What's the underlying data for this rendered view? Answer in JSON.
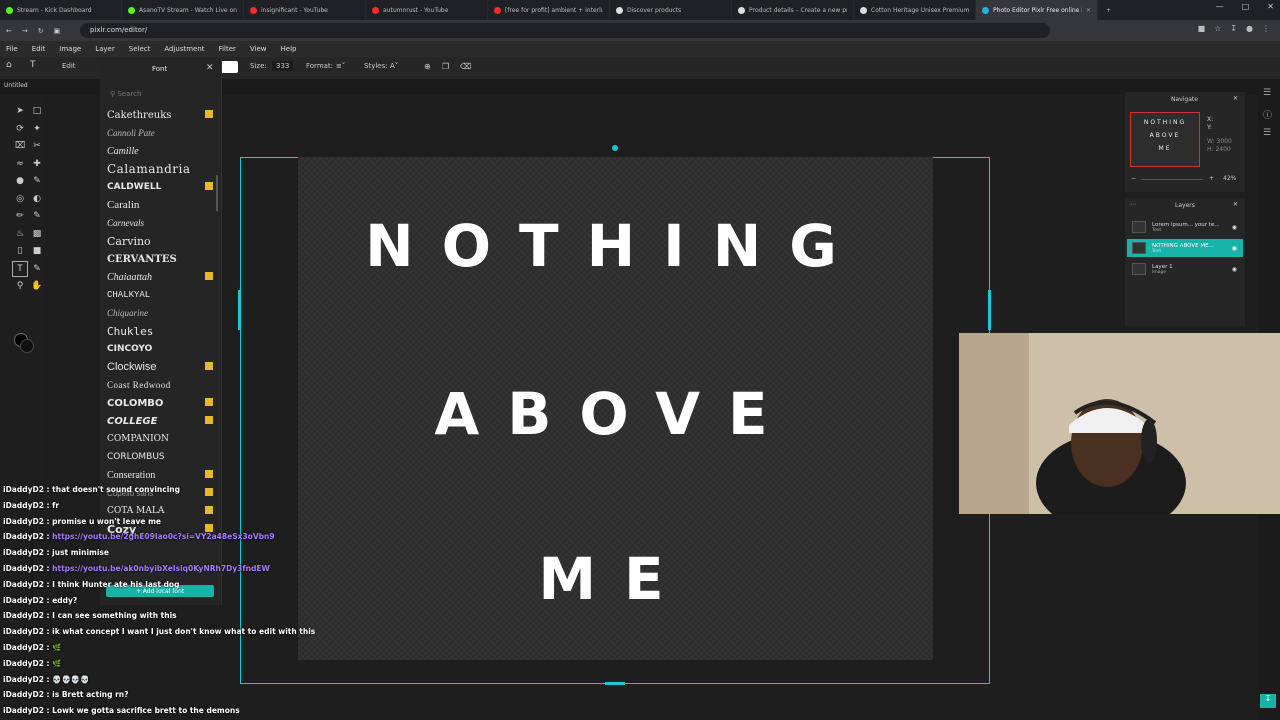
{
  "browser": {
    "tabs": [
      {
        "title": "Stream - Kick Dashboard",
        "fav": "#53fc18"
      },
      {
        "title": "AsanoTV Stream - Watch Live on Kick",
        "fav": "#53fc18"
      },
      {
        "title": "insignificant - YouTube",
        "fav": "#ff2a2a"
      },
      {
        "title": "autumnrust - YouTube",
        "fav": "#ff2a2a"
      },
      {
        "title": "[free for profit] ambient + interlude",
        "fav": "#ff2a2a"
      },
      {
        "title": "Discover products",
        "fav": "#ddd"
      },
      {
        "title": "Product details – Create a new product",
        "fav": "#ddd"
      },
      {
        "title": "Cotton Heritage Unisex Premium H",
        "fav": "#ddd"
      },
      {
        "title": "Photo Editor Pixlr Free online In",
        "fav": "#1fb3e0"
      }
    ],
    "url": "pixlr.com/editor/"
  },
  "menu": [
    "File",
    "Edit",
    "Image",
    "Layer",
    "Select",
    "Adjustment",
    "Filter",
    "View",
    "Help"
  ],
  "toolbar": {
    "edit": "Edit",
    "font_label": "Font",
    "size_label": "Size:",
    "size_value": "333",
    "format_label": "Format:",
    "styles_label": "Styles:"
  },
  "document": {
    "title": "Untitled"
  },
  "font_panel": {
    "title": "Font",
    "search_placeholder": "Search",
    "fonts": [
      {
        "name": "Cakethreuks",
        "star": true
      },
      {
        "name": "Cannoli Pate",
        "star": false
      },
      {
        "name": "Camille",
        "star": false
      },
      {
        "name": "Calamandria",
        "star": false
      },
      {
        "name": "CALDWELL",
        "star": true
      },
      {
        "name": "Caralin",
        "star": false
      },
      {
        "name": "Carnevals",
        "star": false
      },
      {
        "name": "Carvino",
        "star": false
      },
      {
        "name": "CERVANTES",
        "star": false
      },
      {
        "name": "Chaiaattah",
        "star": true
      },
      {
        "name": "CHALKYAL",
        "star": false
      },
      {
        "name": "Chiquarine",
        "star": false
      },
      {
        "name": "Chukles",
        "star": false
      },
      {
        "name": "CINCOYO",
        "star": false
      },
      {
        "name": "Clockwise",
        "star": true
      },
      {
        "name": "Coast Redwood",
        "star": false
      },
      {
        "name": "COLOMBO",
        "star": true
      },
      {
        "name": "COLLEGE",
        "star": true
      },
      {
        "name": "COMPANION",
        "star": false
      },
      {
        "name": "CORLOMBUS",
        "star": false
      },
      {
        "name": "Conseration",
        "star": true
      },
      {
        "name": "Cupello sans",
        "star": true
      },
      {
        "name": "COTA MALA",
        "star": true
      },
      {
        "name": "Cozy",
        "star": true
      }
    ],
    "add_local_font": "Add local font"
  },
  "canvas_text": {
    "line1": "NOTHING",
    "line2": "ABOVE",
    "line3": "ME"
  },
  "navigate": {
    "title": "Navigate",
    "x": "X:",
    "y": "Y:",
    "w": "W: 3000",
    "h": "H: 2400",
    "zoom": "42%",
    "thumb_lines": [
      "NOTHING",
      "ABOVE",
      "ME"
    ]
  },
  "layers": {
    "title": "Layers",
    "items": [
      {
        "name": "Lorem ipsum... your te...",
        "sub": "Text",
        "active": false
      },
      {
        "name": "NOTHING ABOVE ME...",
        "sub": "Text",
        "active": true
      },
      {
        "name": "Layer 1",
        "sub": "Image",
        "active": false
      }
    ]
  },
  "chat": [
    {
      "user": "iDaddyD2",
      "text": "that doesn't sound convincing",
      "kind": "text"
    },
    {
      "user": "iDaddyD2",
      "text": "fr",
      "kind": "text"
    },
    {
      "user": "iDaddyD2",
      "text": "promise u won't leave me",
      "kind": "text"
    },
    {
      "user": "iDaddyD2",
      "text": "https://youtu.be/2ghE09Iao0c?si=VY2a48eSx3oVbn9",
      "kind": "link"
    },
    {
      "user": "iDaddyD2",
      "text": "just minimise",
      "kind": "text"
    },
    {
      "user": "iDaddyD2",
      "text": "https://youtu.be/ak0nbyibXeIsiq0KyNRh7Dy3fndEW",
      "kind": "link"
    },
    {
      "user": "iDaddyD2",
      "text": "I think Hunter ate his last dog",
      "kind": "text"
    },
    {
      "user": "iDaddyD2",
      "text": "eddy?",
      "kind": "text"
    },
    {
      "user": "iDaddyD2",
      "text": "I can see something with this",
      "kind": "text"
    },
    {
      "user": "iDaddyD2",
      "text": "ik what concept I want I just don't know what to edit with this",
      "kind": "text"
    },
    {
      "user": "iDaddyD2",
      "text": "🌿",
      "kind": "emo"
    },
    {
      "user": "iDaddyD2",
      "text": "🌿",
      "kind": "emo"
    },
    {
      "user": "iDaddyD2",
      "text": "💀💀💀💀",
      "kind": "text"
    },
    {
      "user": "iDaddyD2",
      "text": "is Brett acting rn?",
      "kind": "text"
    },
    {
      "user": "iDaddyD2",
      "text": "Lowk we gotta sacrifice brett to the demons",
      "kind": "text"
    }
  ]
}
